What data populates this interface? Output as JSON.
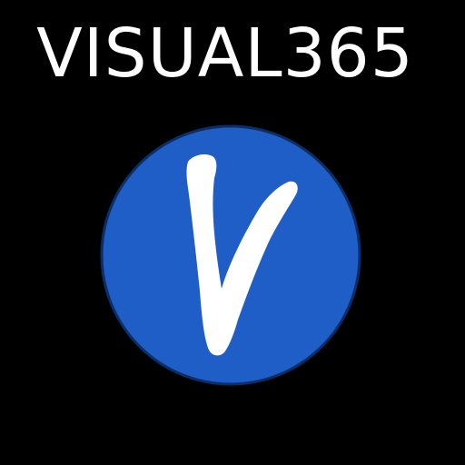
{
  "icon": {
    "title": "VISUAL365",
    "logo_mark": "v-letter-logo-icon",
    "colors": {
      "background": "#000000",
      "title_text": "#ffffff",
      "circle_fill": "#1e5ec6",
      "circle_stroke": "#0b2e66",
      "mark_fill": "#ffffff"
    }
  }
}
